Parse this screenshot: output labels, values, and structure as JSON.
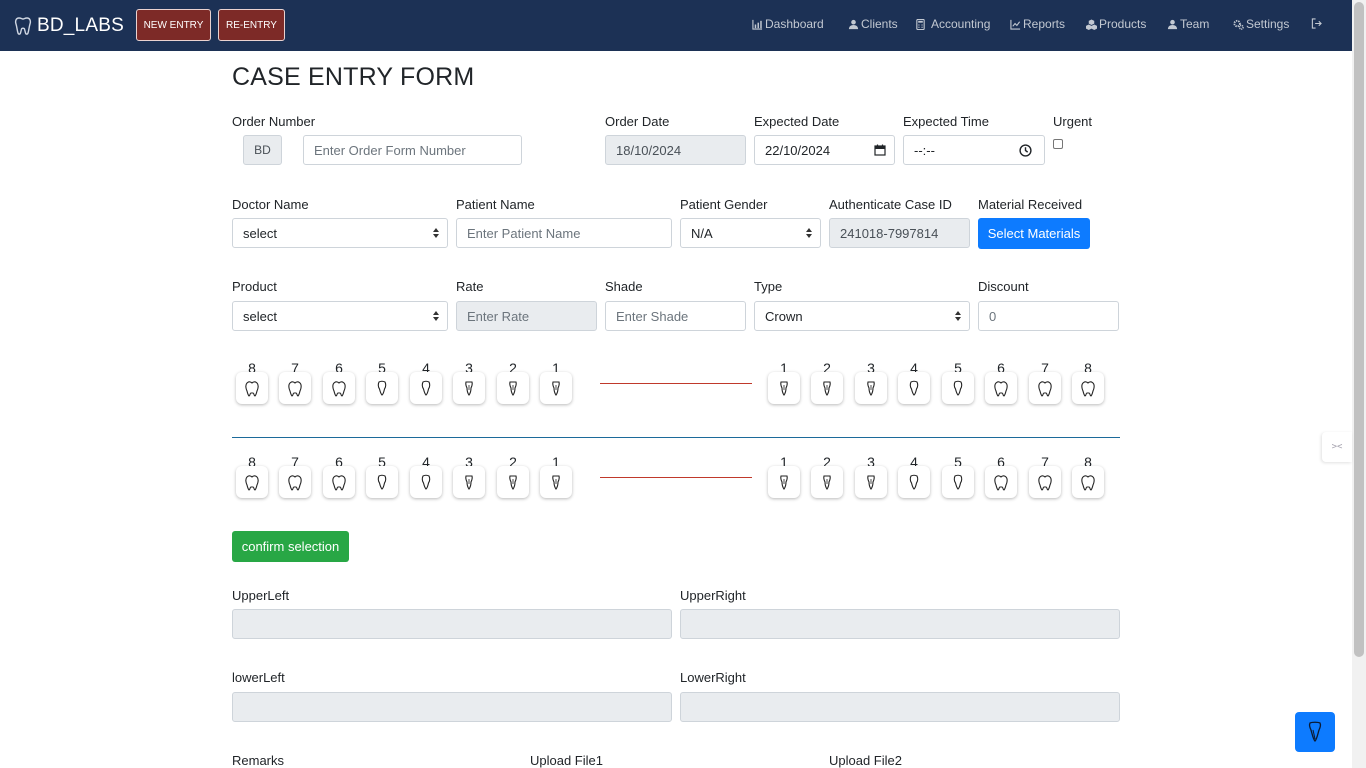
{
  "navbar": {
    "brand": "BD_LABS",
    "new_entry": "NEW ENTRY",
    "re_entry": "RE-ENTRY",
    "links": [
      {
        "label": "Dashboard",
        "icon": "chart-icon"
      },
      {
        "label": "Clients",
        "icon": "user-icon"
      },
      {
        "label": "Accounting",
        "icon": "calculator-icon"
      },
      {
        "label": "Reports",
        "icon": "chart-line-icon"
      },
      {
        "label": "Products",
        "icon": "cubes-icon"
      },
      {
        "label": "Team",
        "icon": "users-icon"
      },
      {
        "label": "Settings",
        "icon": "gears-icon"
      }
    ],
    "logout_icon": "logout-icon"
  },
  "form": {
    "title": "CASE ENTRY FORM",
    "order_number": {
      "label": "Order Number",
      "prefix": "BD",
      "placeholder": "Enter Order Form Number"
    },
    "order_date": {
      "label": "Order Date",
      "value": "18/10/2024"
    },
    "expected_date": {
      "label": "Expected Date",
      "value": "22/10/2024"
    },
    "expected_time": {
      "label": "Expected Time",
      "value": "--:--"
    },
    "urgent": {
      "label": "Urgent",
      "checked": false
    },
    "doctor_name": {
      "label": "Doctor Name",
      "value": "select"
    },
    "patient_name": {
      "label": "Patient Name",
      "placeholder": "Enter Patient Name"
    },
    "patient_gender": {
      "label": "Patient Gender",
      "value": "N/A"
    },
    "case_id": {
      "label": "Authenticate Case ID",
      "value": "241018-7997814"
    },
    "material": {
      "label": "Material Received",
      "button": "Select Materials"
    },
    "product": {
      "label": "Product",
      "value": "select"
    },
    "rate": {
      "label": "Rate",
      "placeholder": "Enter Rate"
    },
    "shade": {
      "label": "Shade",
      "placeholder": "Enter Shade"
    },
    "type": {
      "label": "Type",
      "value": "Crown"
    },
    "discount": {
      "label": "Discount",
      "value": "0"
    },
    "confirm": "confirm selection",
    "upper_left": {
      "label": "UpperLeft",
      "value": ""
    },
    "upper_right": {
      "label": "UpperRight",
      "value": ""
    },
    "lower_left": {
      "label": "lowerLeft",
      "value": ""
    },
    "lower_right": {
      "label": "LowerRight",
      "value": ""
    },
    "remarks": {
      "label": "Remarks"
    },
    "upload1": {
      "label": "Upload File1"
    },
    "upload2": {
      "label": "Upload File2"
    }
  },
  "teeth": {
    "left_numbers": [
      "8",
      "7",
      "6",
      "5",
      "4",
      "3",
      "2",
      "1"
    ],
    "right_numbers": [
      "1",
      "2",
      "3",
      "4",
      "5",
      "6",
      "7",
      "8"
    ]
  },
  "side_widget": "><",
  "colors": {
    "navbar": "#1c3155",
    "entry_button": "#7d2a27",
    "primary": "#0d7bff",
    "success": "#28a745",
    "divider_red": "#c0392b",
    "divider_blue": "#1c6a9a"
  }
}
